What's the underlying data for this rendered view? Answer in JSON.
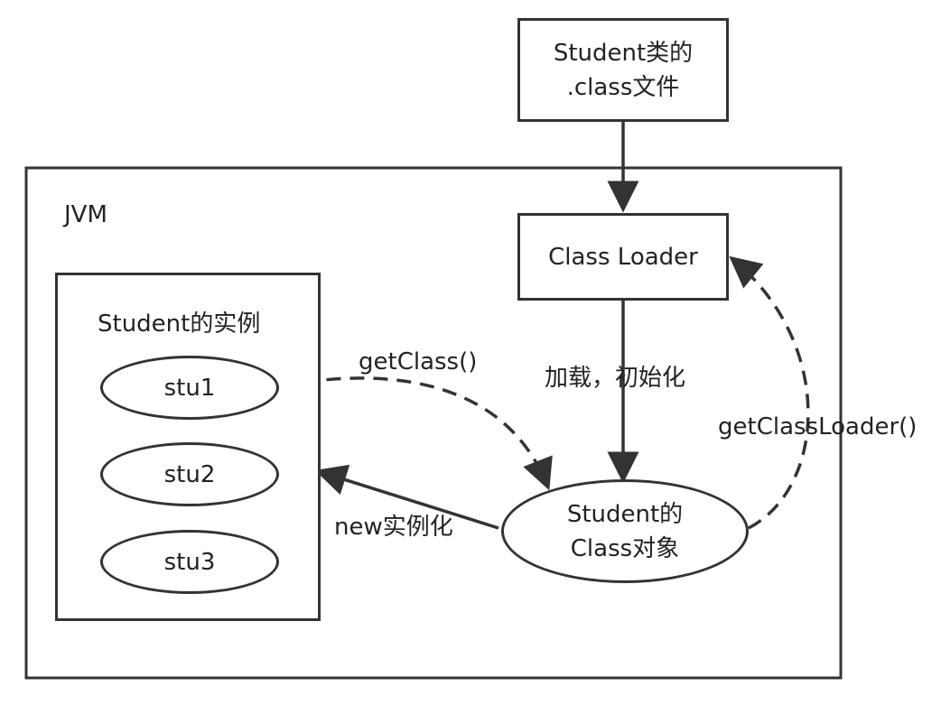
{
  "diagram": {
    "jvm_label": "JVM",
    "class_file": {
      "line1": "Student类的",
      "line2": ".class文件"
    },
    "class_loader": "Class Loader",
    "instances": {
      "title": "Student的实例",
      "items": [
        "stu1",
        "stu2",
        "stu3"
      ]
    },
    "class_object": {
      "line1": "Student的",
      "line2": "Class对象"
    },
    "edges": {
      "get_class": "getClass()",
      "load_init": "加载，初始化",
      "get_class_loader": "getClassLoader()",
      "new_instance": "new实例化"
    },
    "colors": {
      "stroke": "#333333",
      "text": "#222222",
      "background": "#ffffff"
    }
  }
}
